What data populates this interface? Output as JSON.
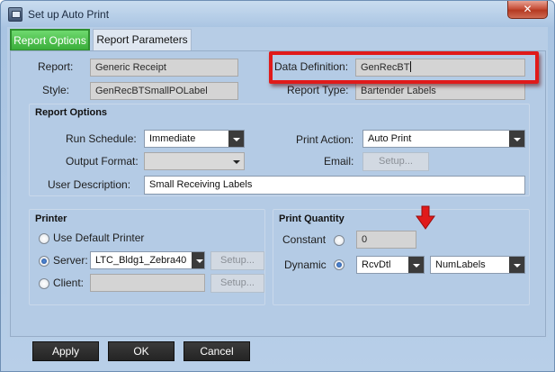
{
  "window": {
    "title": "Set up Auto Print",
    "close_glyph": "✕"
  },
  "tabs": [
    {
      "label": "Report Options",
      "active": true
    },
    {
      "label": "Report Parameters",
      "active": false
    }
  ],
  "report": {
    "report_label": "Report:",
    "report_value": "Generic Receipt",
    "style_label": "Style:",
    "style_value": "GenRecBTSmallPOLabel",
    "data_definition_label": "Data Definition:",
    "data_definition_value": "GenRecBT",
    "report_type_label": "Report Type:",
    "report_type_value": "Bartender Labels"
  },
  "report_options": {
    "title": "Report Options",
    "run_schedule_label": "Run Schedule:",
    "run_schedule_value": "Immediate",
    "output_format_label": "Output Format:",
    "output_format_value": "",
    "user_description_label": "User Description:",
    "user_description_value": "Small Receiving Labels",
    "print_action_label": "Print Action:",
    "print_action_value": "Auto Print",
    "email_label": "Email:",
    "email_setup_label": "Setup..."
  },
  "printer": {
    "title": "Printer",
    "use_default_label": "Use Default Printer",
    "server_label": "Server:",
    "server_value": "LTC_Bldg1_Zebra40",
    "server_setup_label": "Setup...",
    "client_label": "Client:",
    "client_value": "",
    "client_setup_label": "Setup...",
    "selected": "server"
  },
  "print_quantity": {
    "title": "Print Quantity",
    "constant_label": "Constant",
    "constant_value": "0",
    "dynamic_label": "Dynamic",
    "dynamic_table_value": "RcvDtl",
    "dynamic_field_value": "NumLabels",
    "selected": "dynamic"
  },
  "buttons": {
    "apply": "Apply",
    "ok": "OK",
    "cancel": "Cancel"
  },
  "colors": {
    "highlight": "#e01a1a",
    "active_tab": "#3aae3a"
  },
  "icons": {
    "app": "window-icon",
    "close": "close-icon",
    "arrow": "red-arrow-down-icon"
  }
}
